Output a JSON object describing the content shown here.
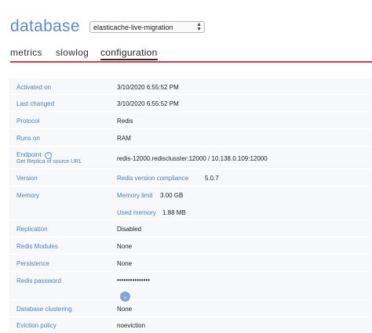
{
  "header": {
    "title": "database",
    "selected_database": "elasticache-live-migration"
  },
  "tabs": [
    {
      "label": "metrics"
    },
    {
      "label": "slowlog"
    },
    {
      "label": "configuration"
    }
  ],
  "config": {
    "activated_on": {
      "label": "Activated on",
      "value": "3/10/2020 6:55:52 PM"
    },
    "last_changed": {
      "label": "Last changed",
      "value": "3/10/2020 6:55:52 PM"
    },
    "protocol": {
      "label": "Protocol",
      "value": "Redis"
    },
    "runs_on": {
      "label": "Runs on",
      "value": "RAM"
    },
    "endpoint": {
      "label": "Endpoint",
      "sub_link": "Get Replica of source URL",
      "value": "redis-12000.redisclusster:12000 / 10.138.0.109:12000"
    },
    "version": {
      "label": "Version",
      "compliance_label": "Redis version compliance",
      "value": "5.0.7"
    },
    "memory": {
      "label": "Memory",
      "limit_label": "Memory limit",
      "limit_value": "3.00 GB",
      "used_label": "Used memory",
      "used_value": "1.88 MB"
    },
    "replication": {
      "label": "Replication",
      "value": "Disabled"
    },
    "redis_modules": {
      "label": "Redis Modules",
      "value": "None"
    },
    "persistence": {
      "label": "Persistence",
      "value": "None"
    },
    "redis_password": {
      "label": "Redis password",
      "value": "•••••••••••••••"
    },
    "database_clustering": {
      "label": "Database clustering",
      "value": "None"
    },
    "eviction_policy": {
      "label": "Eviction policy",
      "value": "noeviction"
    }
  },
  "icons": {
    "info": "info-icon",
    "expand": "chevron-down-icon"
  },
  "colors": {
    "accent": "#5b8dc9",
    "tab_rule": "#e03a4e"
  }
}
